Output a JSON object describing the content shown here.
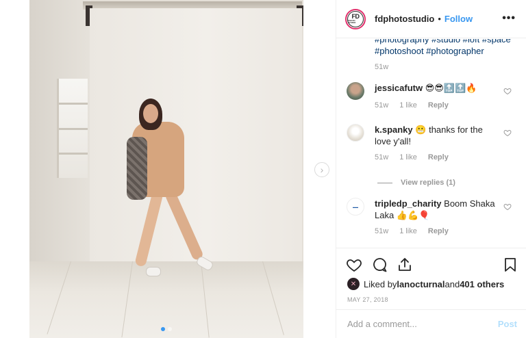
{
  "header": {
    "logo_text_main": "FD",
    "logo_text_sub": "PHOTO STUDIO",
    "username": "fdphotostudio",
    "bullet": "•",
    "follow_label": "Follow",
    "more_label": "•••"
  },
  "caption": {
    "tags_line1": "#photography #studio #loft #space",
    "tags_line2": "#photoshoot #photographer",
    "time": "51w"
  },
  "comments": [
    {
      "username": "jessicafutw",
      "text": "😎😎🔝🔝🔥",
      "time": "51w",
      "likes": "1 like",
      "reply": "Reply"
    },
    {
      "username": "k.spanky",
      "text": "😬 thanks for the love y'all!",
      "time": "51w",
      "likes": "1 like",
      "reply": "Reply"
    },
    {
      "username": "tripledp_charity",
      "text": "Boom Shaka Laka 👍💪🎈",
      "time": "51w",
      "likes": "1 like",
      "reply": "Reply"
    }
  ],
  "view_replies": "View replies (1)",
  "next_arrow": "›",
  "likes": {
    "prefix": "Liked by ",
    "user": "lanocturnal",
    "and": " and ",
    "others": "401 others"
  },
  "date": "MAY 27, 2018",
  "add_comment": {
    "placeholder": "Add a comment...",
    "post_label": "Post"
  },
  "colors": {
    "link_blue": "#3897f0",
    "hashtag": "#003569",
    "muted": "#999999",
    "post_disabled": "#b2dffc"
  },
  "icons": [
    "heart-icon",
    "comment-icon",
    "share-icon",
    "bookmark-icon",
    "more-icon",
    "chevron-right-icon"
  ],
  "carousel": {
    "count": 2,
    "active_index": 0
  }
}
